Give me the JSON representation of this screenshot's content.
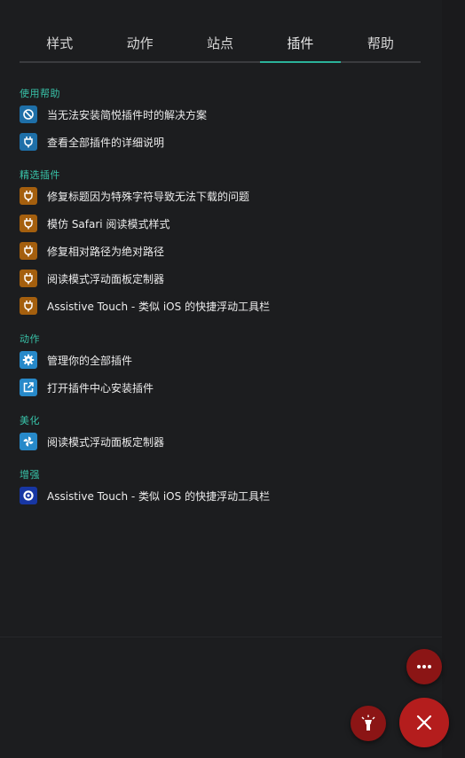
{
  "tabs": [
    {
      "label": "样式"
    },
    {
      "label": "动作"
    },
    {
      "label": "站点"
    },
    {
      "label": "插件",
      "active": true
    },
    {
      "label": "帮助"
    }
  ],
  "sections": {
    "help": {
      "title": "使用帮助",
      "items": [
        {
          "label": "当无法安装简悦插件时的解决方案",
          "icon": "block-icon",
          "color": "#1e6fa8"
        },
        {
          "label": "查看全部插件的详细说明",
          "icon": "plug-icon",
          "color": "#1e6fa8"
        }
      ]
    },
    "featured": {
      "title": "精选插件",
      "items": [
        {
          "label": "修复标题因为特殊字符导致无法下载的问题",
          "icon": "plug-icon",
          "color": "#a45f0e"
        },
        {
          "label": "模仿 Safari 阅读模式样式",
          "icon": "plug-icon",
          "color": "#a45f0e"
        },
        {
          "label": "修复相对路径为绝对路径",
          "icon": "plug-icon",
          "color": "#a45f0e"
        },
        {
          "label": "阅读模式浮动面板定制器",
          "icon": "plug-icon",
          "color": "#a45f0e"
        },
        {
          "label": "Assistive Touch - 类似 iOS 的快捷浮动工具栏",
          "icon": "plug-icon",
          "color": "#a45f0e"
        }
      ]
    },
    "actions": {
      "title": "动作",
      "items": [
        {
          "label": "管理你的全部插件",
          "icon": "gear-icon",
          "color": "#2789c9"
        },
        {
          "label": "打开插件中心安装插件",
          "icon": "external-link-icon",
          "color": "#2789c9"
        }
      ]
    },
    "beautify": {
      "title": "美化",
      "items": [
        {
          "label": "阅读模式浮动面板定制器",
          "icon": "pinwheel-icon",
          "color": "#2789c9"
        }
      ]
    },
    "enhance": {
      "title": "增强",
      "items": [
        {
          "label": "Assistive Touch - 类似 iOS 的快捷浮动工具栏",
          "icon": "target-icon",
          "color": "#1736a3"
        }
      ]
    }
  },
  "fabs": {
    "more": {
      "icon": "more-dots-icon"
    },
    "lightbulb": {
      "icon": "lightbulb-icon"
    },
    "close": {
      "icon": "close-icon"
    }
  },
  "colors": {
    "accent": "#2bb39a",
    "section_title": "#38c2a8",
    "background": "#1c1d1f",
    "fab_red": "#b41d1d",
    "fab_dark_red": "#8b1515"
  }
}
